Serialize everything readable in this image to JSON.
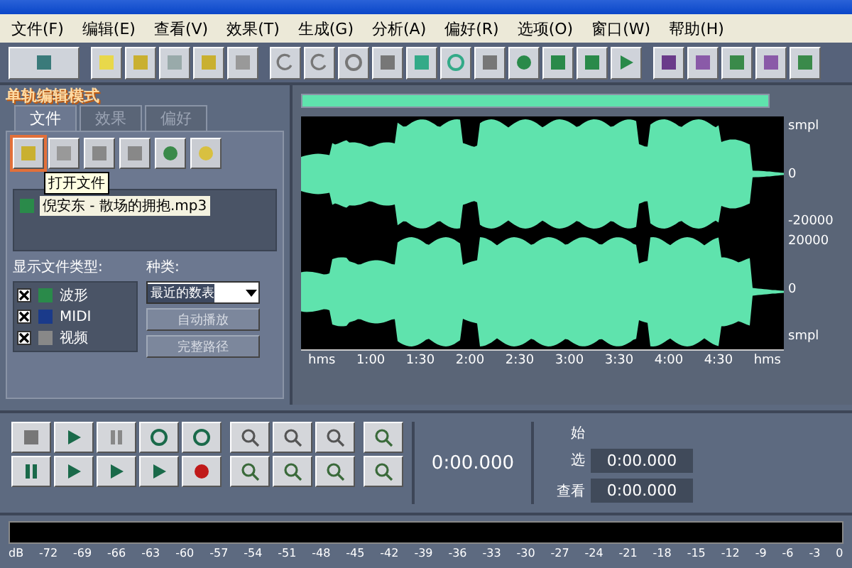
{
  "menu": [
    "文件(F)",
    "编辑(E)",
    "查看(V)",
    "效果(T)",
    "生成(G)",
    "分析(A)",
    "偏好(R)",
    "选项(O)",
    "窗口(W)",
    "帮助(H)"
  ],
  "mode_title": "单轨编辑模式",
  "tabs": [
    {
      "label": "文件",
      "selected": true
    },
    {
      "label": "效果",
      "selected": false
    },
    {
      "label": "偏好",
      "selected": false
    }
  ],
  "tooltip": "打开文件",
  "files": [
    {
      "name": "倪安东 - 散场的拥抱.mp3",
      "selected": true
    }
  ],
  "file_types": {
    "label": "显示文件类型:",
    "items": [
      {
        "label": "波形",
        "checked": true
      },
      {
        "label": "MIDI",
        "checked": true
      },
      {
        "label": "视频",
        "checked": true
      }
    ]
  },
  "sort": {
    "label": "种类:",
    "value": "最近的数表",
    "buttons": [
      "自动播放",
      "完整路径"
    ]
  },
  "channels": [
    {
      "labels": [
        "smpl",
        "0",
        "-20000"
      ]
    },
    {
      "labels": [
        "20000",
        "0",
        "smpl"
      ]
    }
  ],
  "time_ruler": [
    "hms",
    "1:00",
    "1:30",
    "2:00",
    "2:30",
    "3:00",
    "3:30",
    "4:00",
    "4:30",
    "hms"
  ],
  "position": "0:00.000",
  "selection": {
    "header": "始",
    "rows": [
      {
        "label": "选",
        "value": "0:00.000"
      },
      {
        "label": "查看",
        "value": "0:00.000"
      }
    ]
  },
  "meter": {
    "scale": [
      "dB",
      "-72",
      "-69",
      "-66",
      "-63",
      "-60",
      "-57",
      "-54",
      "-51",
      "-48",
      "-45",
      "-42",
      "-39",
      "-36",
      "-33",
      "-30",
      "-27",
      "-24",
      "-21",
      "-18",
      "-15",
      "-12",
      "-9",
      "-6",
      "-3",
      "0"
    ]
  }
}
